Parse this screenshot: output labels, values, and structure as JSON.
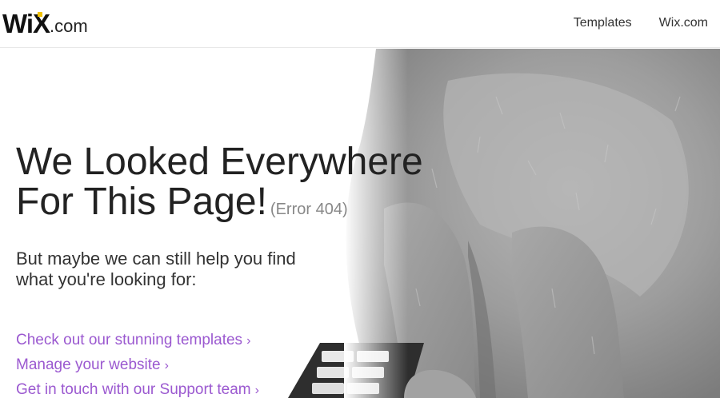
{
  "header": {
    "logo": {
      "brand": "WiX",
      "suffix": ".com",
      "dot_color": "#f2c200"
    },
    "nav": [
      {
        "label": "Templates"
      },
      {
        "label": "Wix.com"
      }
    ]
  },
  "main": {
    "headline_line1": "We Looked Everywhere",
    "headline_line2": "For This Page!",
    "error_code": "(Error 404)",
    "subtitle": "But maybe we can still help you find what you're looking for:",
    "links": [
      {
        "label": "Check out our stunning templates",
        "icon": "chevron-right-icon"
      },
      {
        "label": "Manage your website",
        "icon": "chevron-right-icon"
      },
      {
        "label": "Get in touch with our Support team",
        "icon": "chevron-right-icon"
      }
    ]
  },
  "colors": {
    "link": "#9b59d0",
    "text": "#222222",
    "muted": "#888888",
    "cat_fur": "#9a9a9a"
  }
}
